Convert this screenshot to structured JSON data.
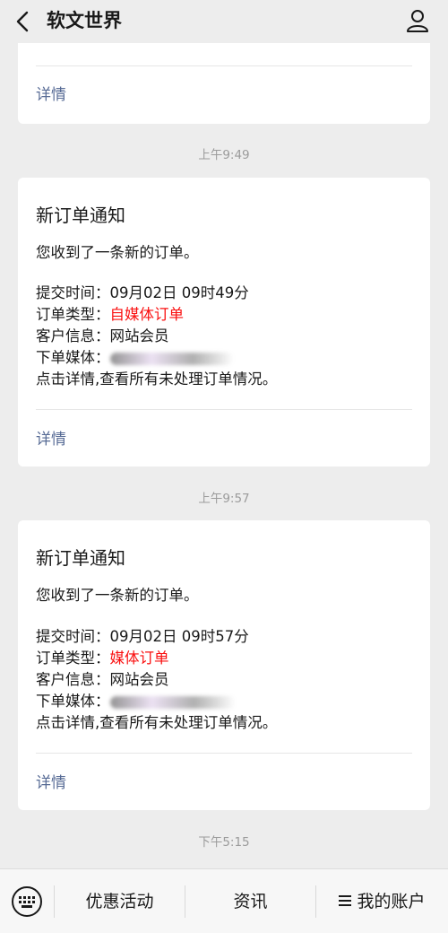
{
  "header": {
    "title": "软文世界"
  },
  "partial_card": {
    "detail_label": "详情"
  },
  "messages": [
    {
      "timestamp": "上午9:49",
      "title": "新订单通知",
      "intro": "您收到了一条新的订单。",
      "submit_time_label": "提交时间：",
      "submit_time_value": "09月02日 09时49分",
      "order_type_label": "订单类型：",
      "order_type_value": "自媒体订单",
      "customer_label": "客户信息：",
      "customer_value": "网站会员",
      "media_label": "下单媒体：",
      "footer_text": "点击详情,查看所有未处理订单情况。",
      "detail_label": "详情"
    },
    {
      "timestamp": "上午9:57",
      "title": "新订单通知",
      "intro": "您收到了一条新的订单。",
      "submit_time_label": "提交时间：",
      "submit_time_value": "09月02日 09时57分",
      "order_type_label": "订单类型：",
      "order_type_value": "媒体订单",
      "customer_label": "客户信息：",
      "customer_value": "网站会员",
      "media_label": "下单媒体：",
      "footer_text": "点击详情,查看所有未处理订单情况。",
      "detail_label": "详情"
    }
  ],
  "last_timestamp": "下午5:15",
  "bottom_menu": {
    "items": [
      {
        "label": "优惠活动"
      },
      {
        "label": "资讯"
      },
      {
        "label": "我的账户"
      }
    ]
  },
  "icons": {
    "back": "chevron-left-icon",
    "user": "user-icon",
    "keyboard": "keyboard-icon",
    "menu": "hamburger-icon"
  },
  "colors": {
    "link": "#576b95",
    "highlight": "#fa0f0f",
    "background": "#ededed"
  }
}
